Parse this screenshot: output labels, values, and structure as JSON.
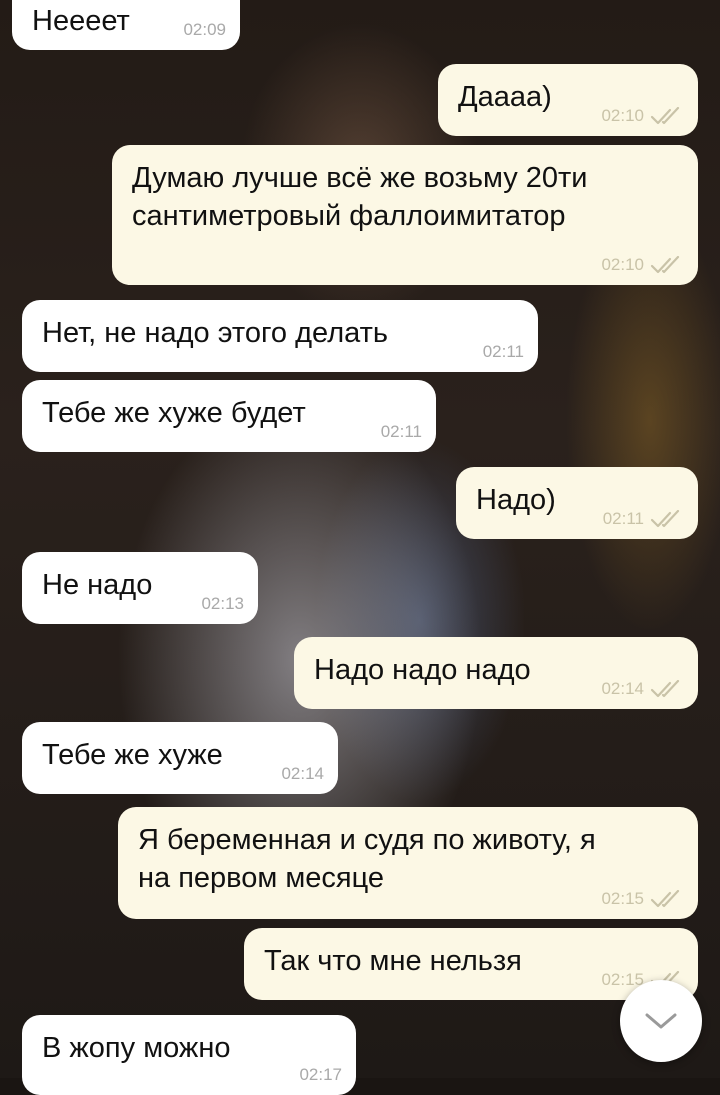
{
  "messages": [
    {
      "id": "m1",
      "dir": "in",
      "lines": [
        "Неееет"
      ],
      "time": "02:09"
    },
    {
      "id": "m2",
      "dir": "out",
      "lines": [
        "Даааа)"
      ],
      "time": "02:10"
    },
    {
      "id": "m3",
      "dir": "out",
      "lines": [
        "Думаю лучше всё же возьму 20ти",
        "сантиметровый фаллоимитатор"
      ],
      "time": "02:10"
    },
    {
      "id": "m4",
      "dir": "in",
      "lines": [
        "Нет, не надо этого делать"
      ],
      "time": "02:11"
    },
    {
      "id": "m5",
      "dir": "in",
      "lines": [
        "Тебе же хуже будет"
      ],
      "time": "02:11"
    },
    {
      "id": "m6",
      "dir": "out",
      "lines": [
        "Надо)"
      ],
      "time": "02:11"
    },
    {
      "id": "m7",
      "dir": "in",
      "lines": [
        "Не надо"
      ],
      "time": "02:13"
    },
    {
      "id": "m8",
      "dir": "out",
      "lines": [
        "Надо надо надо"
      ],
      "time": "02:14"
    },
    {
      "id": "m9",
      "dir": "in",
      "lines": [
        "Тебе же хуже"
      ],
      "time": "02:14"
    },
    {
      "id": "m10",
      "dir": "out",
      "lines": [
        "Я беременная и судя по животу, я",
        "на первом месяце"
      ],
      "time": "02:15"
    },
    {
      "id": "m11",
      "dir": "out",
      "lines": [
        "Так что мне нельзя"
      ],
      "time": "02:15"
    },
    {
      "id": "m12",
      "dir": "in",
      "lines": [
        "В жопу можно"
      ],
      "time": "02:17"
    }
  ],
  "colors": {
    "incoming_bubble": "#ffffff",
    "outgoing_bubble": "#fcf8e5",
    "read_check": "#c9c3a8",
    "time_text": "#a9a9a9"
  },
  "icons": {
    "read_receipt": "double-check-icon",
    "scroll_down": "chevron-down-icon"
  }
}
